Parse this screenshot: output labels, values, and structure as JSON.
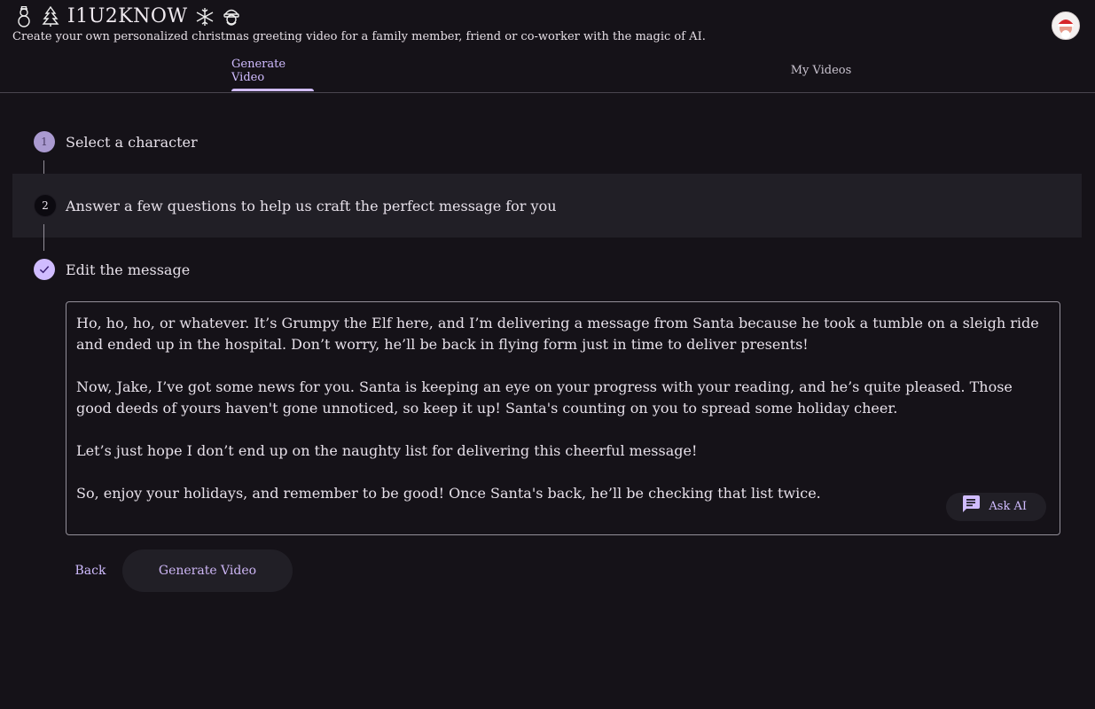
{
  "header": {
    "title": "I1U2KNOW",
    "tagline": "Create your own personalized christmas greeting video for a family member, friend or co-worker with the magic of AI.",
    "icons": [
      "snowman-icon",
      "christmas-tree-icon",
      "snowflake-icon",
      "santa-icon"
    ]
  },
  "tabs": [
    {
      "label": "Generate Video",
      "active": true
    },
    {
      "label": "My Videos",
      "active": false
    }
  ],
  "steps": [
    {
      "number": "1",
      "label": "Select a character",
      "state": "pending"
    },
    {
      "number": "2",
      "label": "Answer a few questions to help us craft the perfect message for you",
      "state": "current"
    },
    {
      "number": "",
      "label": "Edit the message",
      "state": "done"
    }
  ],
  "message": {
    "paragraphs": [
      "Ho, ho, ho, or whatever. It’s Grumpy the Elf here, and I’m delivering a message from Santa because he took a tumble on a sleigh ride and ended up in the hospital. Don’t worry, he’ll be back in flying form just in time to deliver presents!",
      "Now, Jake, I’ve got some news for you. Santa is keeping an eye on your progress with your reading, and he’s quite pleased. Those good deeds of yours haven't gone unnoticed, so keep it up! Santa's counting on you to spread some holiday cheer.",
      "Let’s just hope I don’t end up on the naughty list for delivering this cheerful message!",
      "So, enjoy your holidays, and remember to be good! Once Santa's back, he’ll be checking that list twice."
    ],
    "ask_ai_label": "Ask AI"
  },
  "actions": {
    "back_label": "Back",
    "generate_label": "Generate Video"
  },
  "colors": {
    "background": "#151218",
    "accent": "#d0bcff",
    "surface": "#211f26"
  }
}
